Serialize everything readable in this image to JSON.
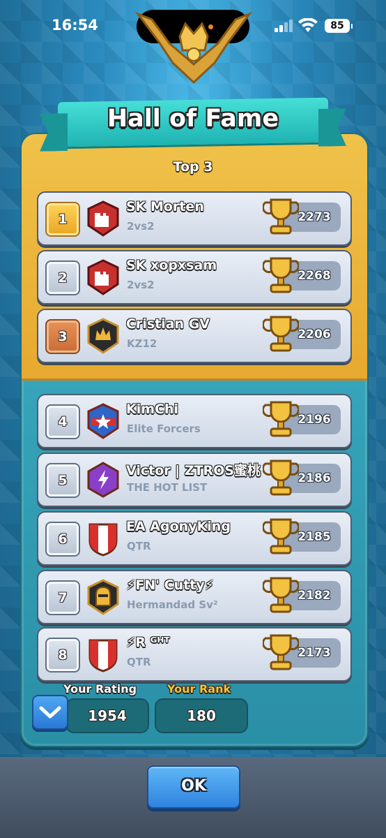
{
  "status_bar": {
    "time": "16:54",
    "battery": "85"
  },
  "panel": {
    "title": "Hall of Fame",
    "top_heading": "Top 3"
  },
  "icons": {
    "trophy": "trophy-icon",
    "crown": "crown-emblem-icon",
    "collapse": "chevron-down-icon"
  },
  "players": [
    {
      "rank": "1",
      "name": "SK Morten",
      "clan": "2vs2",
      "trophies": "2273",
      "badge": "red-castle-badge",
      "rank_style": "gold"
    },
    {
      "rank": "2",
      "name": "SK xopxsam",
      "clan": "2vs2",
      "trophies": "2268",
      "badge": "red-castle-badge",
      "rank_style": "silver"
    },
    {
      "rank": "3",
      "name": "Cristian GV",
      "clan": "KZ12",
      "trophies": "2206",
      "badge": "black-crown-badge",
      "rank_style": "bronze"
    },
    {
      "rank": "4",
      "name": "KimChi",
      "clan": "Elite Forcers",
      "trophies": "2196",
      "badge": "blue-star-badge",
      "rank_style": "silver"
    },
    {
      "rank": "5",
      "name": "Victor | ZTROS蜜桃",
      "clan": "THE HOT LIST",
      "trophies": "2186",
      "badge": "purple-lightning-badge",
      "rank_style": "silver"
    },
    {
      "rank": "6",
      "name": "EA AgonyKing",
      "clan": "QTR",
      "trophies": "2185",
      "badge": "red-white-shield-badge",
      "rank_style": "silver"
    },
    {
      "rank": "7",
      "name": "⚡FN' Cutty⚡",
      "clan": "Hermandad Sv²",
      "trophies": "2182",
      "badge": "knight-helmet-badge",
      "rank_style": "silver"
    },
    {
      "rank": "8",
      "name": "⚡R ᴳᴴᵀ",
      "clan": "QTR",
      "trophies": "2173",
      "badge": "red-white-shield-badge",
      "rank_style": "silver"
    }
  ],
  "your_rating": {
    "label": "Your Rating",
    "value": "1954"
  },
  "your_rank": {
    "label": "Your Rank",
    "value": "180"
  },
  "ok_button": "OK",
  "colors": {
    "gold": "#f0c24a",
    "teal": "#3fb2c8",
    "rating_label": "#ffffff",
    "rank_label": "#ffc234"
  }
}
